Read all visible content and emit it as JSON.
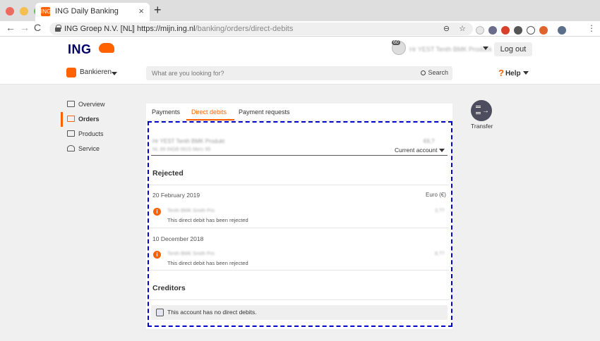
{
  "browser": {
    "tab_title": "ING Daily Banking",
    "tab_favicon": "ING",
    "close_glyph": "×",
    "new_tab_glyph": "+",
    "back_glyph": "←",
    "forward_glyph": "→",
    "reload_glyph": "C",
    "menu_glyph": "⋮",
    "site_identity": "ING Groep N.V. [NL]",
    "separator": "|",
    "url_host": "https://mijn.ing.nl",
    "url_path": "/banking/orders/direct-debits",
    "zoom_glyph": "⊖",
    "bookmark_glyph": "☆"
  },
  "header": {
    "logo": "ING",
    "user_badge": "60",
    "user_name": "Hr YEST Tenth BMK Produck",
    "logout_label": "Log out",
    "bank_menu_label": "Bankieren",
    "search_placeholder": "What are you looking for?",
    "search_button_label": "Search",
    "help_glyph": "?",
    "help_label": "Help"
  },
  "sidebar": {
    "items": [
      {
        "label": "Overview",
        "icon": "wallet-icon"
      },
      {
        "label": "Orders",
        "icon": "calendar-icon",
        "active": true
      },
      {
        "label": "Products",
        "icon": "bank-icon"
      },
      {
        "label": "Service",
        "icon": "person-icon"
      }
    ]
  },
  "tabs": {
    "payments": "Payments",
    "direct_debits": "Direct debits",
    "payment_requests": "Payment requests"
  },
  "account": {
    "name": "Hr YEST Tenth BMK Produkt",
    "iban": "NL 99 INGB 0615 Merc 95",
    "balance": "€6,?",
    "selector_label": "Current account"
  },
  "rejected": {
    "title": "Rejected",
    "currency_label": "Euro (€)",
    "groups": [
      {
        "date": "20 February 2019",
        "payee": "Tenth BMK Smith Pro",
        "amount": "3,??",
        "status": "This direct debit has been rejected"
      },
      {
        "date": "10 December 2018",
        "payee": "Tenth BMK Smith Pro",
        "amount": "8,??",
        "status": "This direct debit has been rejected"
      }
    ]
  },
  "creditors": {
    "title": "Creditors",
    "empty_message": "This account has no direct debits."
  },
  "transfer": {
    "label": "Transfer",
    "arrow_glyph": "→"
  },
  "colors": {
    "accent": "#ff6200",
    "brand_navy": "#000066",
    "highlight_border": "#0000cc"
  }
}
